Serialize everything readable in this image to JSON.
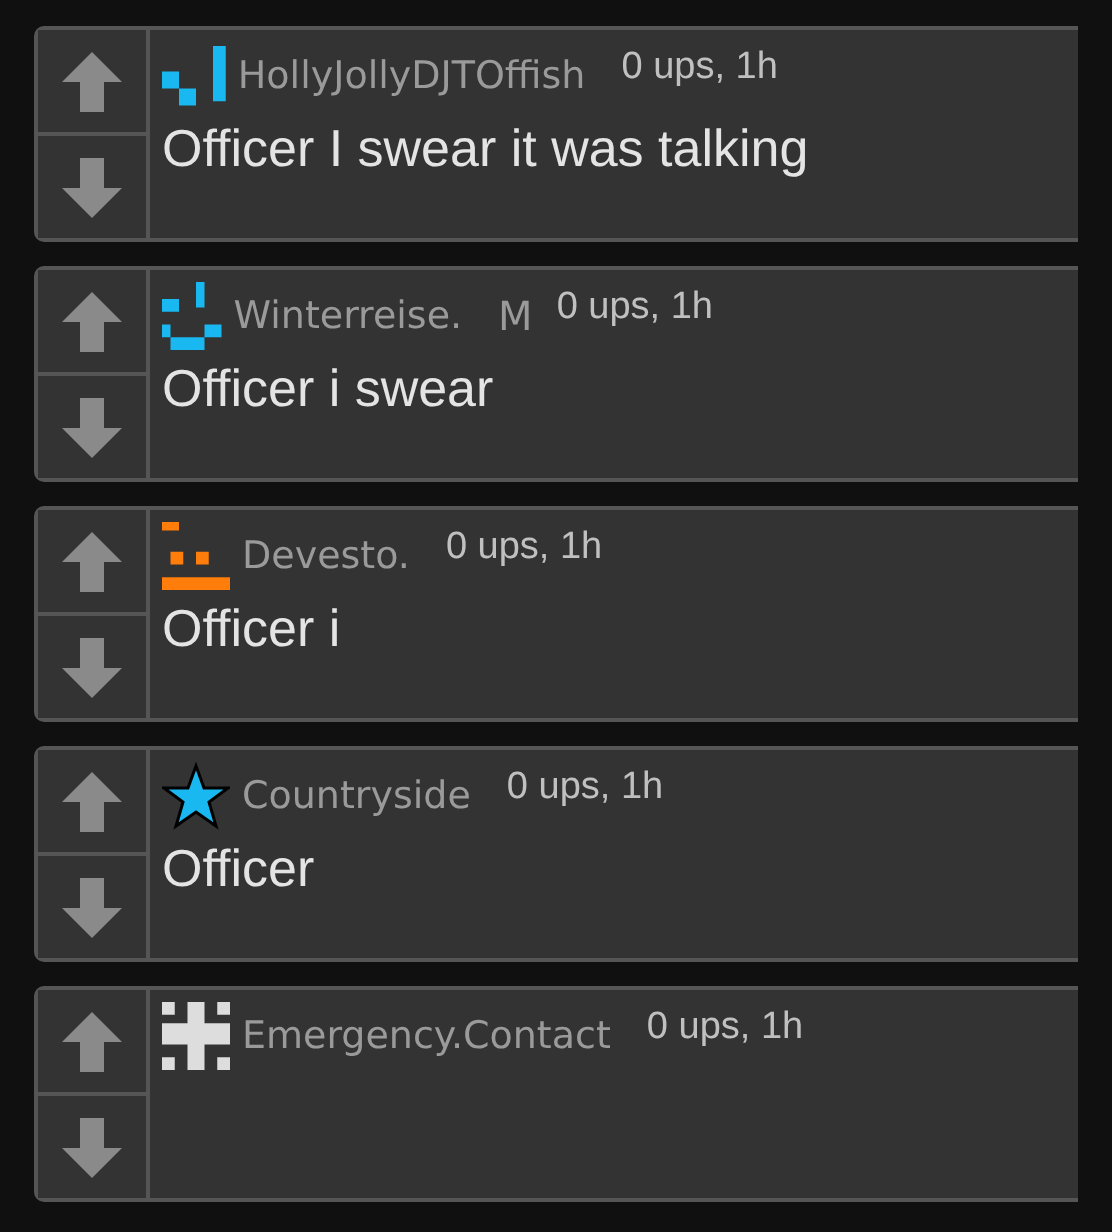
{
  "comments": [
    {
      "avatar": {
        "kind": "check",
        "color": "#1ab8f0"
      },
      "username": "HollyJollyDJTOffish",
      "meta": "0 ups, 1h",
      "text": "Officer I swear it was talking"
    },
    {
      "avatar": {
        "kind": "smile",
        "color": "#1ab8f0"
      },
      "username": "Winterreise.",
      "badge": "M",
      "meta": "0 ups, 1h",
      "text": "Officer i swear"
    },
    {
      "avatar": {
        "kind": "face",
        "color": "#ff7d0a"
      },
      "username": "Devesto.",
      "meta": "0 ups, 1h",
      "text": "Officer i"
    },
    {
      "avatar": {
        "kind": "star",
        "color": "#1ab8f0"
      },
      "username": "Countryside",
      "meta": "0 ups, 1h",
      "text": "Officer"
    },
    {
      "avatar": {
        "kind": "cross",
        "color": "#dddddd"
      },
      "username": "Emergency.Contact",
      "meta": "0 ups, 1h"
    }
  ]
}
